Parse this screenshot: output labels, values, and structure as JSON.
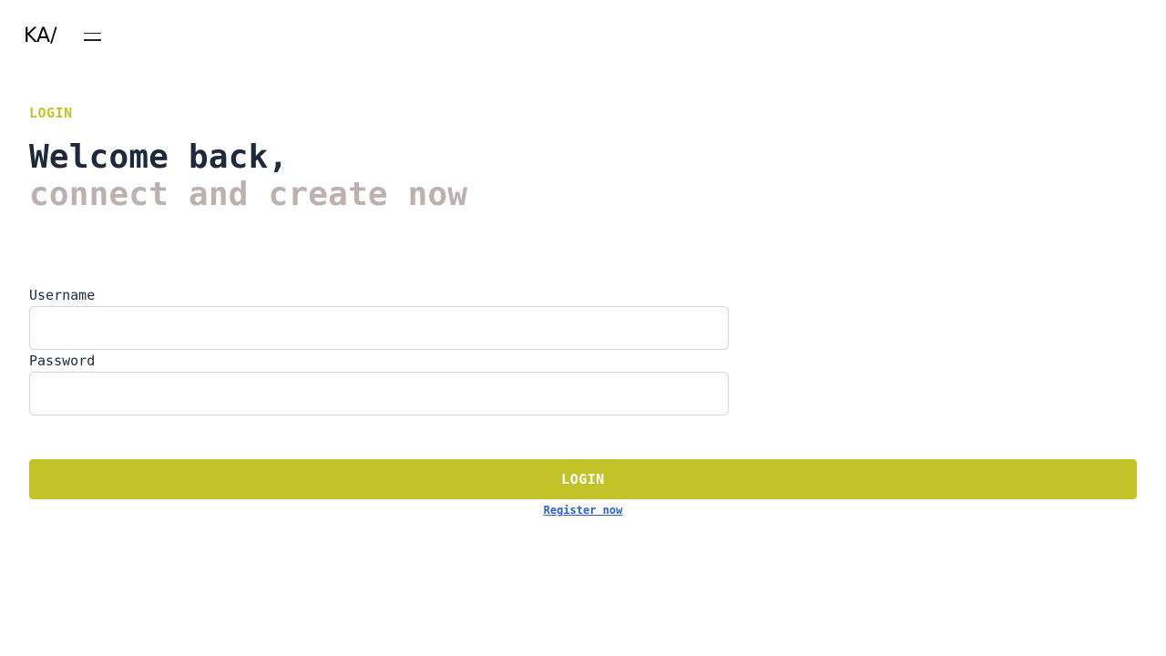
{
  "header": {
    "logo_text": "KA/",
    "menu_icon": "hamburger-menu-icon"
  },
  "login": {
    "eyebrow": "LOGIN",
    "headline_line1": "Welcome back,",
    "headline_line2": "connect and create now",
    "username_label": "Username",
    "username_value": "",
    "password_label": "Password",
    "password_value": "",
    "submit_label": "LOGIN",
    "register_link": "Register now"
  },
  "colors": {
    "accent": "#c4c229",
    "headline_primary": "#1e293b",
    "headline_secondary": "#bcb0b0",
    "link": "#2f5fd6"
  }
}
